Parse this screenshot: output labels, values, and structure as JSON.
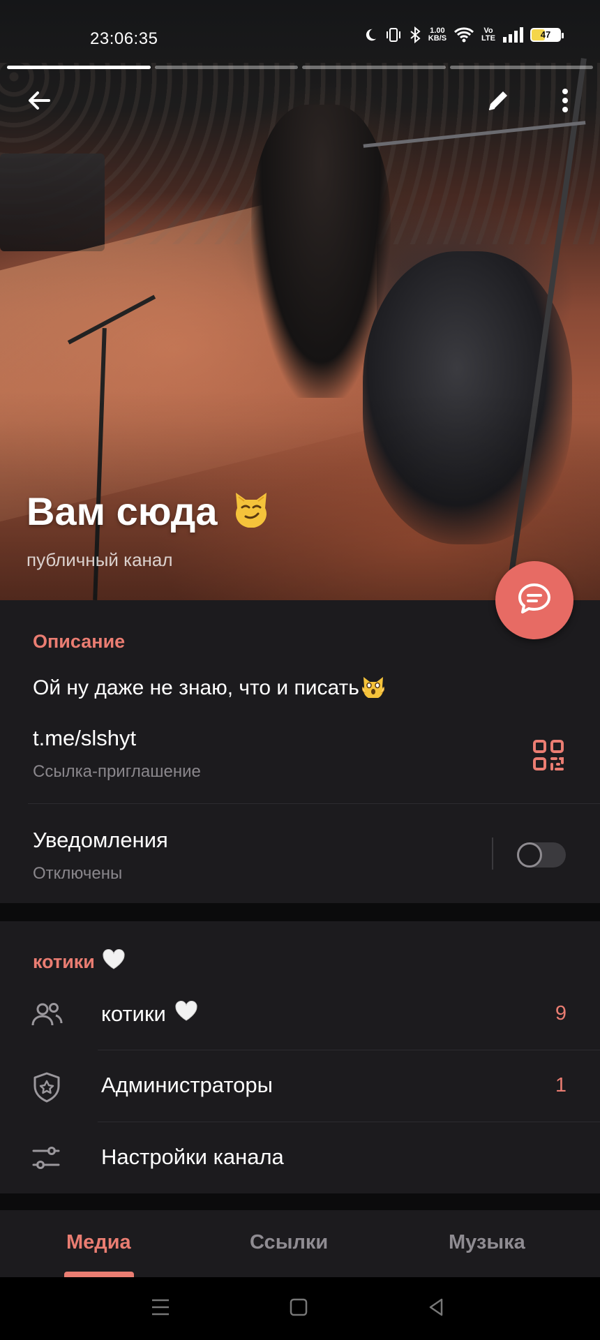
{
  "status_bar": {
    "time": "23:06:35",
    "net_speed_value": "1.00",
    "net_speed_unit": "KB/S",
    "volte_top": "Vo",
    "volte_bottom": "LTE",
    "battery_level": "47"
  },
  "story_progress": {
    "segments": 4,
    "active_index": 0
  },
  "header": {
    "title": "Вам сюда",
    "title_emoji": "smirking-cat-face",
    "subtitle": "публичный канал"
  },
  "info": {
    "description_header": "Описание",
    "description_text": "Ой ну даже не знаю, что и писать",
    "description_emoji": "weary-cat-face",
    "link": "t.me/slshyt",
    "link_caption": "Ссылка-приглашение",
    "notifications_label": "Уведомления",
    "notifications_state": "Отключены",
    "notifications_enabled": false
  },
  "group": {
    "header": "котики",
    "rows": [
      {
        "label": "котики",
        "count": "9",
        "icon": "people-icon",
        "emoji": "white-heart"
      },
      {
        "label": "Администраторы",
        "count": "1",
        "icon": "shield-star-icon"
      },
      {
        "label": "Настройки канала",
        "count": "",
        "icon": "sliders-icon"
      }
    ]
  },
  "tabs": [
    {
      "label": "Медиа",
      "active": true
    },
    {
      "label": "Ссылки",
      "active": false
    },
    {
      "label": "Музыка",
      "active": false
    }
  ],
  "colors": {
    "accent": "#ea7d72",
    "fab": "#e76b64",
    "surface": "#1c1b1e",
    "secondary_text": "#8a878c"
  }
}
